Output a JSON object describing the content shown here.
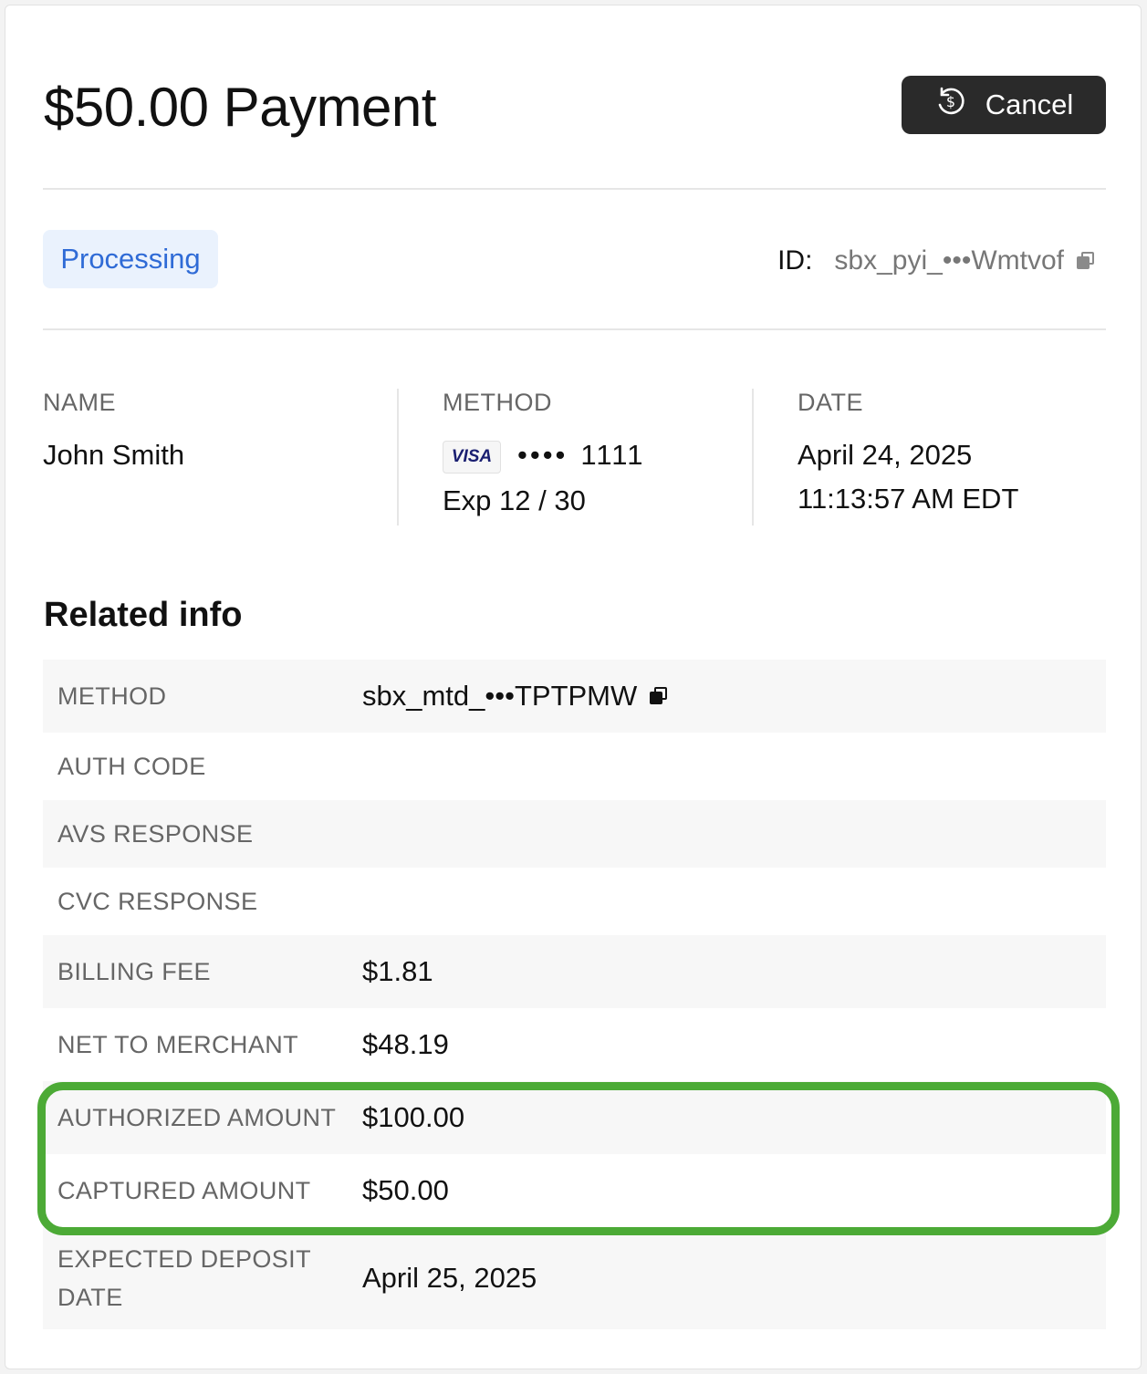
{
  "header": {
    "title": "$50.00 Payment",
    "cancel_label": "Cancel",
    "cancel_icon": "refund-dollar-icon"
  },
  "status": {
    "badge": "Processing",
    "badge_color": "#2f6bd6",
    "id_label": "ID:",
    "id_value": "sbx_pyi_•••Wmtvof"
  },
  "summary": {
    "name_label": "NAME",
    "name_value": "John Smith",
    "method_label": "METHOD",
    "card_brand": "VISA",
    "card_dots": "••••",
    "card_last4": "1111",
    "card_exp": "Exp 12 / 30",
    "date_label": "DATE",
    "date_value": "April 24, 2025",
    "time_value": "11:13:57 AM EDT"
  },
  "related": {
    "title": "Related info",
    "rows": [
      {
        "label": "METHOD",
        "value": "sbx_mtd_•••TPTPMW"
      },
      {
        "label": "AUTH CODE",
        "value": ""
      },
      {
        "label": "AVS RESPONSE",
        "value": ""
      },
      {
        "label": "CVC RESPONSE",
        "value": ""
      },
      {
        "label": "BILLING FEE",
        "value": "$1.81"
      },
      {
        "label": "NET TO MERCHANT",
        "value": "$48.19"
      },
      {
        "label": "AUTHORIZED AMOUNT",
        "value": "$100.00"
      },
      {
        "label": "CAPTURED AMOUNT",
        "value": "$50.00"
      },
      {
        "label": "EXPECTED DEPOSIT DATE",
        "value": "April 25, 2025"
      }
    ]
  },
  "highlight_color": "#4caa36"
}
